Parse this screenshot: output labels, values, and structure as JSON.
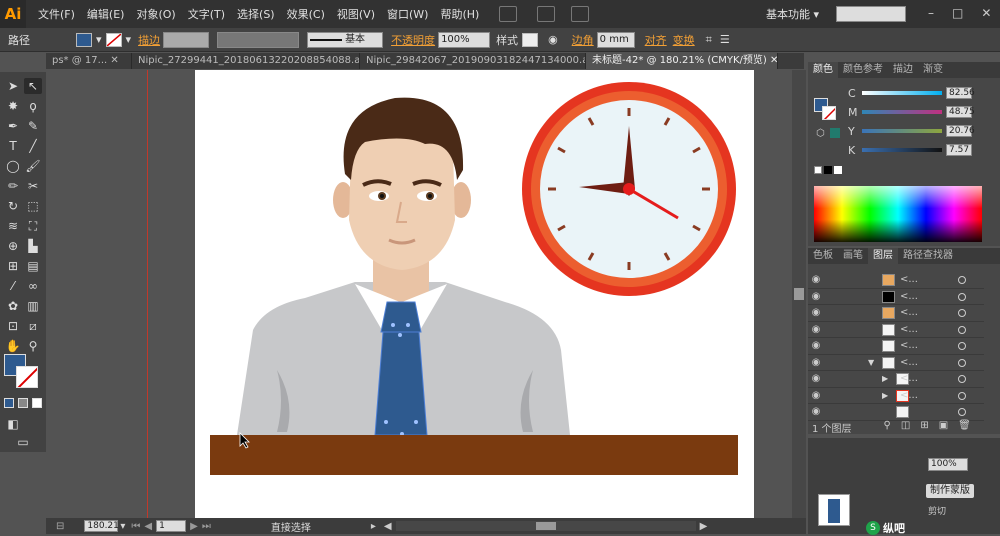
{
  "app": {
    "logo": "Ai",
    "workspace": "基本功能"
  },
  "menus": [
    "文件(F)",
    "编辑(E)",
    "对象(O)",
    "文字(T)",
    "选择(S)",
    "效果(C)",
    "视图(V)",
    "窗口(W)",
    "帮助(H)"
  ],
  "control": {
    "selection_label": "路径",
    "stroke_link": "描边",
    "stroke_style": "基本",
    "opacity_link": "不透明度",
    "opacity_value": "100%",
    "style_label": "样式",
    "corner_link": "边角",
    "corner_value": "0 mm",
    "align_link": "对齐",
    "transform_link": "变换",
    "fill_color": "#2e5a8f",
    "stroke_color": "none"
  },
  "tabs": [
    {
      "label": "ps* @ 17...",
      "active": false
    },
    {
      "label": "Nipic_27299441_20180613220208854088.ai*",
      "active": false
    },
    {
      "label": "Nipic_29842067_20190903182447134000.ai*",
      "active": false
    },
    {
      "label": "未标题-42* @ 180.21% (CMYK/预览)",
      "active": true
    }
  ],
  "color_panel": {
    "tabs": [
      "颜色",
      "颜色参考",
      "描边",
      "渐变"
    ],
    "channels": [
      {
        "name": "C",
        "value": "82.56"
      },
      {
        "name": "M",
        "value": "48.75"
      },
      {
        "name": "Y",
        "value": "20.76"
      },
      {
        "name": "K",
        "value": "7.57"
      }
    ]
  },
  "layers_panel": {
    "tabs": [
      "色板",
      "画笔",
      "图层",
      "路径查找器"
    ],
    "rows": [
      "<...",
      "<...",
      "<...",
      "<...",
      "<...",
      "<...",
      "<...",
      "<...",
      ""
    ],
    "footer": "1 个图层"
  },
  "transparency": {
    "opacity": "100%",
    "mask_button": "制作蒙版",
    "clip_label": "剪切"
  },
  "status": {
    "zoom": "180.21",
    "page": "1",
    "tool": "直接选择"
  },
  "watermark": {
    "brand": "纵吧"
  },
  "colors": {
    "tie": "#2e5a8f",
    "desk": "#7a3a0f",
    "shirt": "#c7c8ca",
    "hair": "#4a2a17",
    "skin": "#efcfb3",
    "clock_rim": "#e53520"
  }
}
